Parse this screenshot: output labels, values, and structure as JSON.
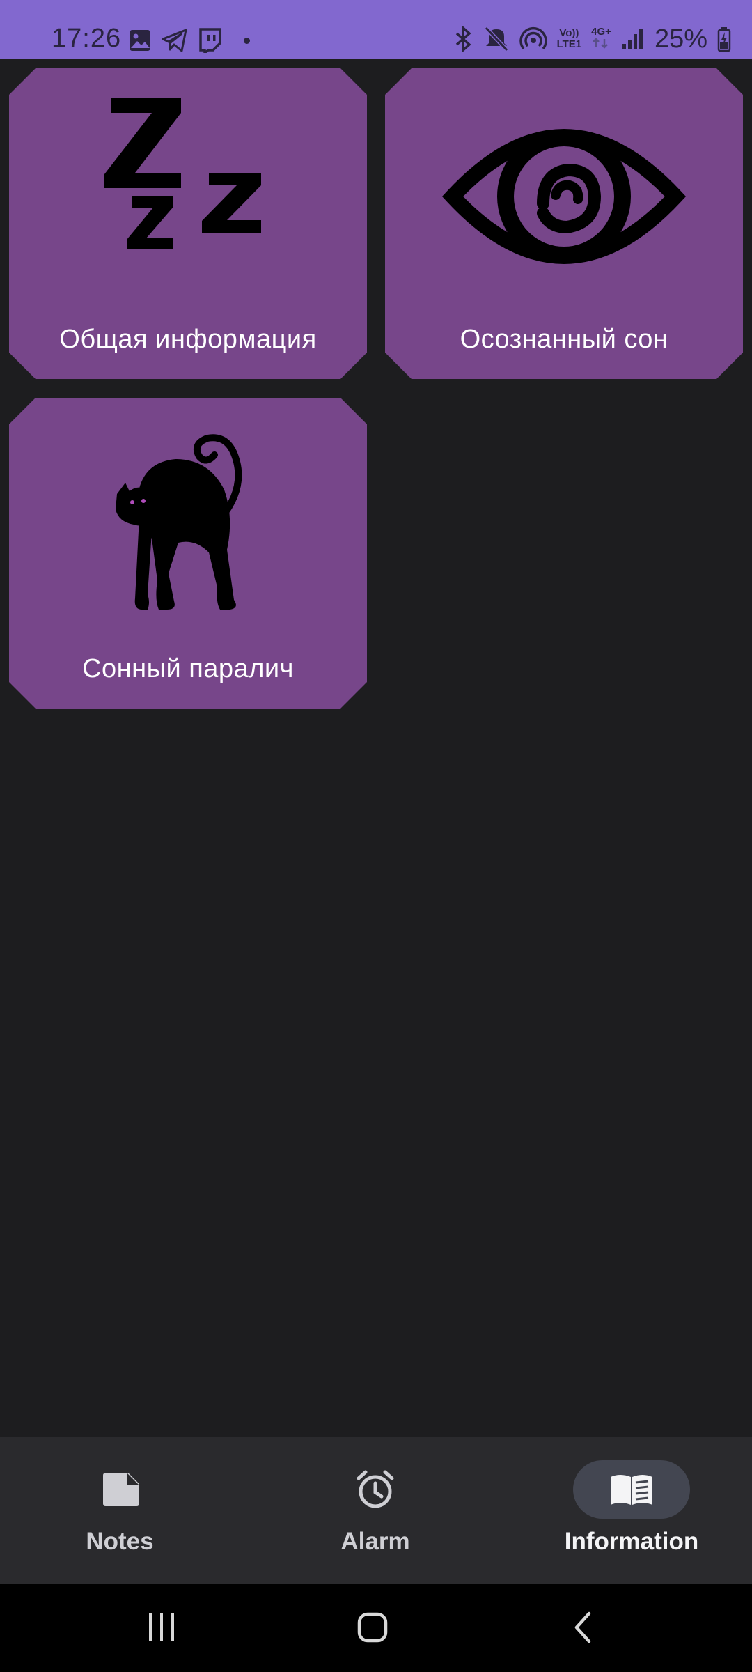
{
  "status_bar": {
    "time": "17:26",
    "battery": "25%",
    "network_top": "Vo))",
    "network_bottom": "LTE1",
    "network_gen": "4G+",
    "left_icons": [
      "gallery-icon",
      "telegram-icon",
      "twitch-icon",
      "dot"
    ],
    "right_icons": [
      "bluetooth-icon",
      "mute-icon",
      "hotspot-icon",
      "signal-icon",
      "battery-charging-icon"
    ]
  },
  "tiles": [
    {
      "label": "Общая информация",
      "icon": "zzz-sleep-icon"
    },
    {
      "label": "Осознанный сон",
      "icon": "eye-icon"
    },
    {
      "label": "Сонный паралич",
      "icon": "black-cat-icon"
    }
  ],
  "bottom_nav": {
    "items": [
      {
        "label": "Notes",
        "icon": "note-icon",
        "active": false
      },
      {
        "label": "Alarm",
        "icon": "alarm-clock-icon",
        "active": false
      },
      {
        "label": "Information",
        "icon": "book-icon",
        "active": true
      }
    ]
  },
  "system_bar": {
    "buttons": [
      "recent-apps-icon",
      "home-icon",
      "back-icon"
    ]
  },
  "colors": {
    "status_bar": "#8268cf",
    "background": "#1d1d1f",
    "tile": "#77468a",
    "nav_background": "#2a2a2d",
    "nav_active_pill": "#434651"
  }
}
